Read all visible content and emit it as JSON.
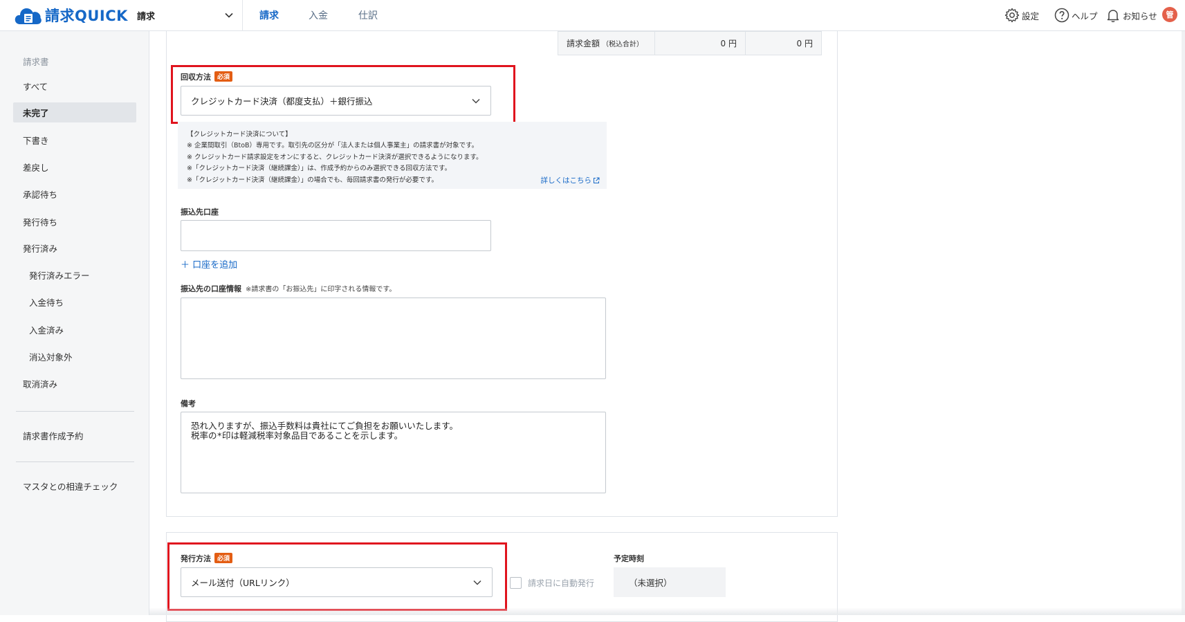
{
  "header": {
    "logo_text": "請求QUICK",
    "app_select": "請求",
    "tabs": [
      {
        "label": "請求",
        "active": true
      },
      {
        "label": "入金",
        "active": false
      },
      {
        "label": "仕訳",
        "active": false
      }
    ],
    "settings_label": "設定",
    "help_label": "ヘルプ",
    "notice_label": "お知らせ",
    "avatar_initial": "管",
    "accent_color": "#1668c7"
  },
  "sidebar": {
    "section_heading": "請求書",
    "items": [
      {
        "label": "すべて"
      },
      {
        "label": "未完了",
        "active": true
      },
      {
        "label": "下書き"
      },
      {
        "label": "差戻し"
      },
      {
        "label": "承認待ち"
      },
      {
        "label": "発行待ち"
      },
      {
        "label": "発行済み"
      },
      {
        "label": "発行済みエラー"
      },
      {
        "label": "入金待ち"
      },
      {
        "label": "入金済み"
      },
      {
        "label": "消込対象外"
      },
      {
        "label": "取消済み"
      },
      {
        "label": "請求書作成予約"
      },
      {
        "label": "マスタとの相違チェック"
      }
    ]
  },
  "amount": {
    "label": "請求金額",
    "label_note": "（税込合計）",
    "value1": "0 円",
    "value2": "0 円"
  },
  "collection": {
    "label": "回収方法",
    "required_badge": "必須",
    "selected": "クレジットカード決済（都度支払）＋銀行振込",
    "info_lines": [
      "【クレジットカード決済について】",
      "※ 企業間取引（BtoB）専用です。取引先の区分が「法人または個人事業主」の請求書が対象です。",
      "※ クレジットカード請求設定をオンにすると、クレジットカード決済が選択できるようになります。",
      "※「クレジットカード決済（継続課金）」は、作成予約からのみ選択できる回収方法です。",
      "※「クレジットカード決済（継続課金）」の場合でも、毎回請求書の発行が必要です。"
    ],
    "details_link": "詳しくはこちら"
  },
  "bank_account": {
    "label": "振込先口座",
    "value": "",
    "add_link": "＋ 口座を追加"
  },
  "bank_info": {
    "label": "振込先の口座情報",
    "note": "※請求書の「お振込先」に印字される情報です。",
    "value": ""
  },
  "remarks": {
    "label": "備考",
    "lines": [
      "恐れ入りますが、振込手数料は貴社にてご負担をお願いいたします。",
      "税率の*印は軽減税率対象品目であることを示します。"
    ]
  },
  "issue": {
    "label": "発行方法",
    "required_badge": "必須",
    "selected": "メール送付（URLリンク）",
    "auto_issue_label": "請求日に自動発行",
    "auto_issue_checked": false,
    "scheduled_label": "予定時刻",
    "scheduled_value": "（未選択）"
  }
}
